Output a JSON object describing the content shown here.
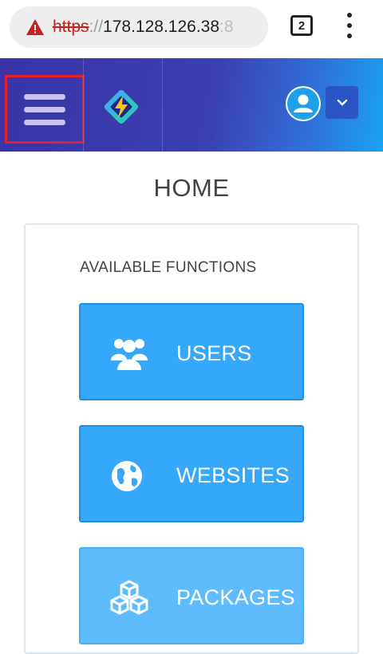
{
  "browser": {
    "url_scheme": "https",
    "url_separator": "://",
    "url_host": "178.128.126.38",
    "url_port_fragment": ":8",
    "tab_count": "2"
  },
  "header": {
    "menu_icon": "hamburger-menu-icon",
    "logo_icon": "app-logo-icon",
    "avatar_icon": "user-avatar-icon",
    "dropdown_icon": "chevron-down-icon",
    "highlight_color": "#e0202a"
  },
  "page": {
    "title": "HOME",
    "section_label": "AVAILABLE FUNCTIONS",
    "functions": [
      {
        "label": "USERS",
        "icon": "users-icon"
      },
      {
        "label": "WEBSITES",
        "icon": "globe-icon"
      },
      {
        "label": "PACKAGES",
        "icon": "boxes-icon"
      }
    ]
  },
  "colors": {
    "header_start": "#3a33a8",
    "header_end": "#1aa3f2",
    "button_blue": "#35a8fb"
  }
}
